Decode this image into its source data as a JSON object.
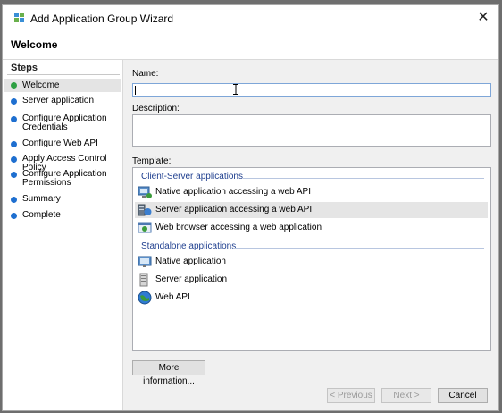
{
  "window": {
    "title": "Add Application Group Wizard",
    "close_glyph": "✕"
  },
  "header": {
    "page_title": "Welcome"
  },
  "steps": {
    "heading": "Steps",
    "items": [
      {
        "label": "Welcome",
        "current": true
      },
      {
        "label": "Server application"
      },
      {
        "label": "Configure Application",
        "label2": "Credentials"
      },
      {
        "label": "Configure Web API"
      },
      {
        "label": "Apply Access Control Policy"
      },
      {
        "label": "Configure Application",
        "label2": "Permissions"
      },
      {
        "label": "Summary"
      },
      {
        "label": "Complete"
      }
    ]
  },
  "form": {
    "name_label": "Name:",
    "name_value": "",
    "description_label": "Description:",
    "template_label": "Template:"
  },
  "templates": {
    "groups": [
      {
        "title": "Client-Server applications",
        "items": [
          {
            "label": "Native application accessing a web API",
            "icon": "native-client-icon"
          },
          {
            "label": "Server application accessing a web API",
            "icon": "server-client-icon",
            "selected": true
          },
          {
            "label": "Web browser accessing a web application",
            "icon": "web-browser-icon"
          }
        ]
      },
      {
        "title": "Standalone applications",
        "items": [
          {
            "label": "Native application",
            "icon": "native-app-icon"
          },
          {
            "label": "Server application",
            "icon": "server-app-icon"
          },
          {
            "label": "Web API",
            "icon": "globe-icon"
          }
        ]
      }
    ]
  },
  "buttons": {
    "more_info": "More information...",
    "previous": "< Previous",
    "next": "Next >",
    "cancel": "Cancel"
  },
  "colors": {
    "accent": "#1e6fd0",
    "current_step": "#2ea043",
    "group_header": "#1f3f8f"
  }
}
